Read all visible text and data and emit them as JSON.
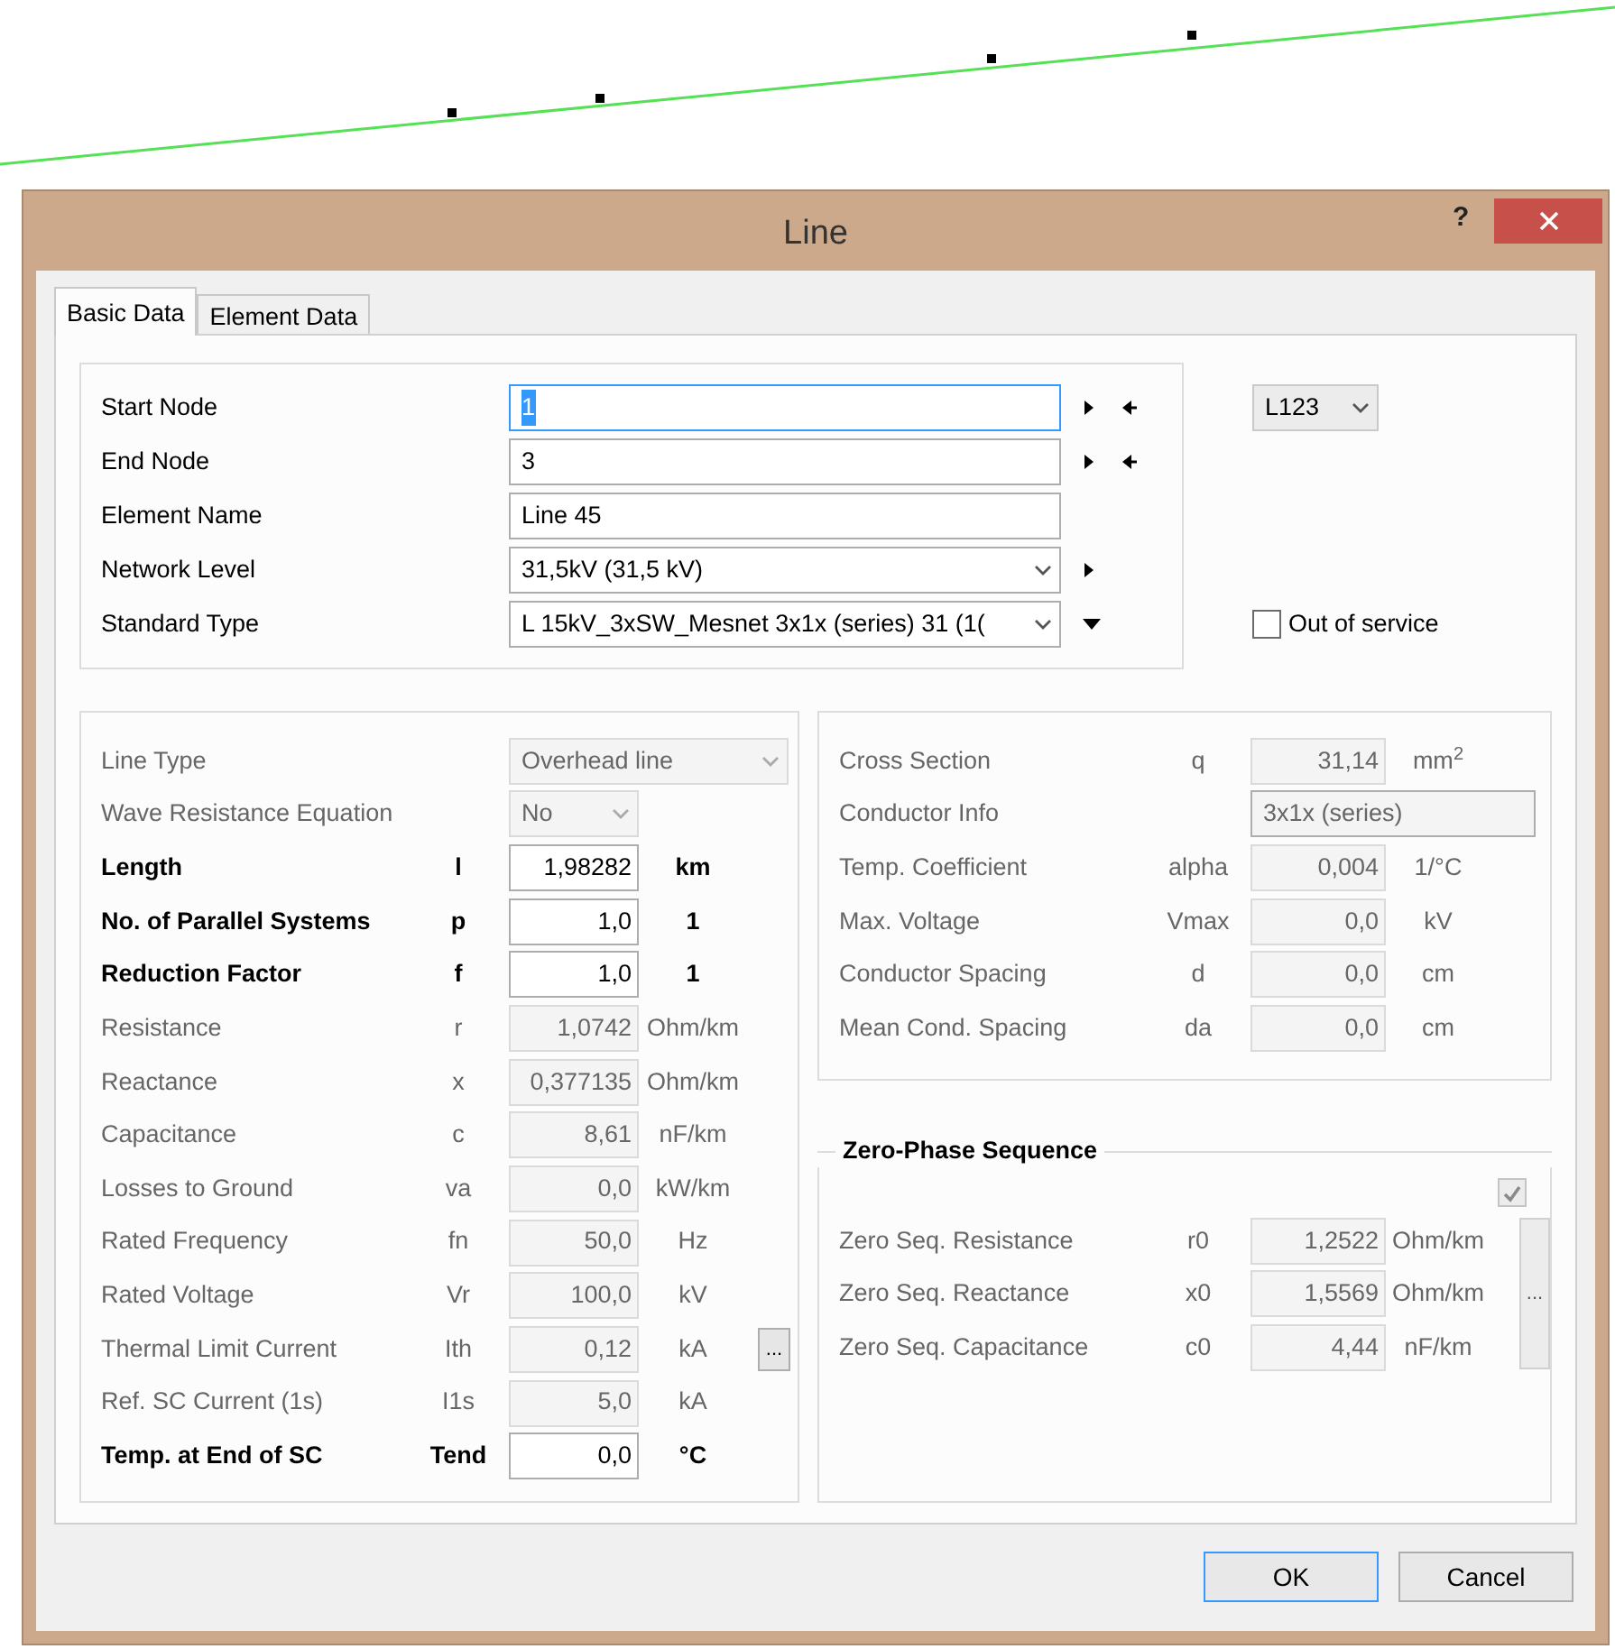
{
  "window": {
    "title": "Line",
    "help": "?"
  },
  "tabs": [
    {
      "label": "Basic Data",
      "selected": true
    },
    {
      "label": "Element Data",
      "selected": false
    }
  ],
  "general": {
    "rows": [
      {
        "label": "Start Node",
        "value": "1",
        "kind": "input",
        "focused": true,
        "next_arrow": true,
        "prev_arrow": true
      },
      {
        "label": "End Node",
        "value": "3",
        "kind": "input",
        "focused": false,
        "next_arrow": true,
        "prev_arrow": true
      },
      {
        "label": "Element Name",
        "value": "Line 45",
        "kind": "input",
        "focused": false
      },
      {
        "label": "Network Level",
        "value": "31,5kV (31,5 kV)",
        "kind": "select",
        "focused": false,
        "next_arrow": true
      },
      {
        "label": "Standard Type",
        "value": "L  15kV_3xSW_Mesnet 3x1x (series) 31 (1(",
        "kind": "select",
        "focused": false,
        "down_arrow": true
      }
    ],
    "variant": {
      "value": "L123"
    },
    "out_of_service": {
      "label": "Out of service",
      "checked": false
    }
  },
  "line_parameters": [
    {
      "label": "Line Type",
      "kind": "select",
      "value": "Overhead line",
      "wide": true,
      "disabled": true
    },
    {
      "label": "Wave Resistance Equation",
      "kind": "select",
      "value": "No",
      "wide": false,
      "disabled": true
    },
    {
      "label": "Length",
      "symbol": "l",
      "kind": "input",
      "value": "1,98282",
      "unit": "km",
      "disabled": false
    },
    {
      "label": "No. of Parallel Systems",
      "symbol": "p",
      "kind": "input",
      "value": "1,0",
      "unit": "1",
      "disabled": false
    },
    {
      "label": "Reduction Factor",
      "symbol": "f",
      "kind": "input",
      "value": "1,0",
      "unit": "1",
      "disabled": false
    },
    {
      "label": "Resistance",
      "symbol": "r",
      "kind": "input",
      "value": "1,0742",
      "unit": "Ohm/km",
      "disabled": true
    },
    {
      "label": "Reactance",
      "symbol": "x",
      "kind": "input",
      "value": "0,377135",
      "unit": "Ohm/km",
      "disabled": true
    },
    {
      "label": "Capacitance",
      "symbol": "c",
      "kind": "input",
      "value": "8,61",
      "unit": "nF/km",
      "disabled": true
    },
    {
      "label": "Losses to Ground",
      "symbol": "va",
      "kind": "input",
      "value": "0,0",
      "unit": "kW/km",
      "disabled": true
    },
    {
      "label": "Rated Frequency",
      "symbol": "fn",
      "kind": "input",
      "value": "50,0",
      "unit": "Hz",
      "disabled": true
    },
    {
      "label": "Rated Voltage",
      "symbol": "Vr",
      "kind": "input",
      "value": "100,0",
      "unit": "kV",
      "disabled": true
    },
    {
      "label": "Thermal Limit Current",
      "symbol": "Ith",
      "kind": "input",
      "value": "0,12",
      "unit": "kA",
      "disabled": true,
      "more_button": "..."
    },
    {
      "label": "Ref. SC Current (1s)",
      "symbol": "I1s",
      "kind": "input",
      "value": "5,0",
      "unit": "kA",
      "disabled": true
    },
    {
      "label": "Temp. at End of SC",
      "symbol": "Tend",
      "kind": "input",
      "value": "0,0",
      "unit": "°C",
      "disabled": false
    }
  ],
  "conductor_parameters": [
    {
      "label": "Cross Section",
      "symbol": "q",
      "kind": "input",
      "value": "31,14",
      "unit": "mm$^{2}$",
      "disabled": true
    },
    {
      "label": "Conductor Info",
      "kind": "text",
      "value": "3x1x (series)",
      "disabled": true
    },
    {
      "label": "Temp. Coefficient",
      "symbol": "alpha",
      "kind": "input",
      "value": "0,004",
      "unit": "1/°C",
      "disabled": true
    },
    {
      "label": "Max. Voltage",
      "symbol": "Vmax",
      "kind": "input",
      "value": "0,0",
      "unit": "kV",
      "disabled": true
    },
    {
      "label": "Conductor Spacing",
      "symbol": "d",
      "kind": "input",
      "value": "0,0",
      "unit": "cm",
      "disabled": true
    },
    {
      "label": "Mean Cond. Spacing",
      "symbol": "da",
      "kind": "input",
      "value": "0,0",
      "unit": "cm",
      "disabled": true
    }
  ],
  "zero_phase_sequence": {
    "title": "Zero-Phase Sequence",
    "checked": true,
    "more_button": "...",
    "rows": [
      {
        "label": "Zero Seq. Resistance",
        "symbol": "r0",
        "value": "1,2522",
        "unit": "Ohm/km",
        "disabled": true
      },
      {
        "label": "Zero Seq. Reactance",
        "symbol": "x0",
        "value": "1,5569",
        "unit": "Ohm/km",
        "disabled": true
      },
      {
        "label": "Zero Seq. Capacitance",
        "symbol": "c0",
        "value": "4,44",
        "unit": "nF/km",
        "disabled": true
      }
    ]
  },
  "buttons": [
    {
      "label": "OK",
      "default": true
    },
    {
      "label": "Cancel",
      "default": false
    }
  ]
}
